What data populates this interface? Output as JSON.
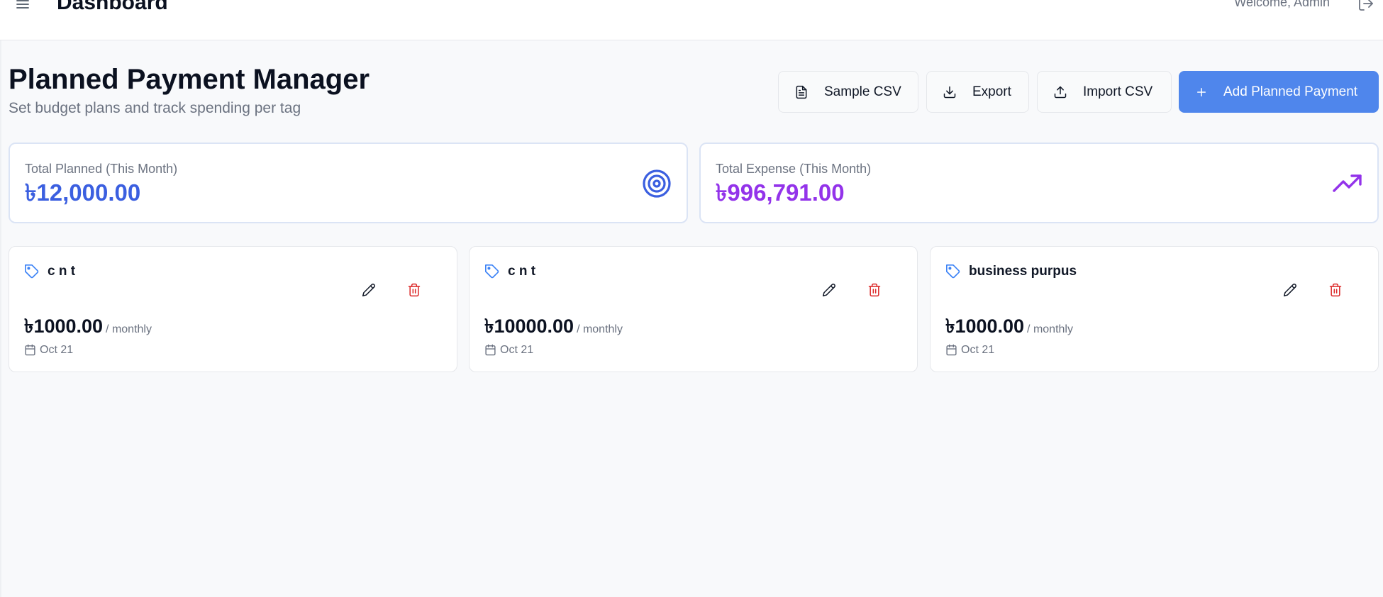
{
  "header": {
    "title": "Dashboard",
    "welcome": "Welcome, Admin",
    "menu_icon": "menu-icon",
    "logout_icon": "logout-icon"
  },
  "page": {
    "title": "Planned Payment Manager",
    "subtitle": "Set budget plans and track spending per tag"
  },
  "actions": {
    "sample_csv": "Sample CSV",
    "export": "Export",
    "import_csv": "Import CSV",
    "add": "Add Planned Payment"
  },
  "summary": {
    "planned": {
      "label": "Total Planned (This Month)",
      "value": "৳12,000.00",
      "color": "#3b5fe0",
      "icon": "target-icon"
    },
    "expense": {
      "label": "Total Expense (This Month)",
      "value": "৳996,791.00",
      "color": "#9333ea",
      "icon": "trending-up-icon"
    }
  },
  "payments": [
    {
      "tag": "c n t",
      "amount": "৳1000.00",
      "period": "/ monthly",
      "date": "Oct 21"
    },
    {
      "tag": "c n t",
      "amount": "৳10000.00",
      "period": "/ monthly",
      "date": "Oct 21"
    },
    {
      "tag": "business purpus",
      "amount": "৳1000.00",
      "period": "/ monthly",
      "date": "Oct 21"
    }
  ],
  "colors": {
    "primary": "#4f86ec",
    "danger": "#dc2626",
    "tag_icon": "#3b82f6"
  }
}
